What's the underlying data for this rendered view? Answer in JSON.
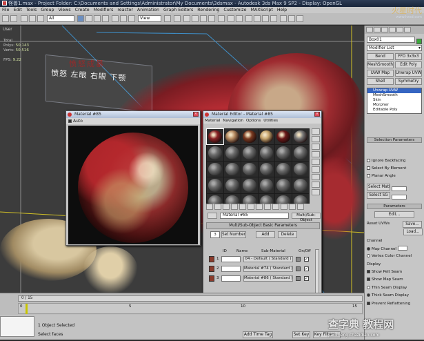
{
  "title": "怪兽1.max - Project Folder: C:\\Documents and Settings\\Administrator\\My Documents\\3dsmax - Autodesk 3ds Max 9 SP2 - Display: OpenGL",
  "menu": [
    "File",
    "Edit",
    "Tools",
    "Group",
    "Views",
    "Create",
    "Modifiers",
    "reactor",
    "Animation",
    "Graph Editors",
    "Rendering",
    "Customize",
    "MAXScript",
    "Help"
  ],
  "toolbar": {
    "selection_filter": "All",
    "ref_coord": "View"
  },
  "viewport": {
    "label": "User",
    "stats_total": "Total",
    "polys_label": "Polys:",
    "polys": "50,143",
    "verts_label": "Verts:",
    "verts": "50,516",
    "fps_label": "FPS:",
    "fps": "9.22",
    "banner_top": "愤怒成暴",
    "banner": "愤怒  左眼  右眼   下颚"
  },
  "logo": {
    "main": "火星时代",
    "sub": "www.hxsd.com"
  },
  "panel": {
    "object_name": "Box01",
    "modifier_list": "Modifier List",
    "buttons": [
      "Bend",
      "FFD 3x3x3",
      "MeshSmooth",
      "Edit Poly",
      "UVW Map",
      "Unwrap UVW",
      "Shell",
      "Symmetry"
    ],
    "stack": [
      "Unwrap UVW",
      "MeshSmooth",
      "Skin",
      "Morpher",
      "Editable Poly"
    ],
    "selection_params": "Selection Parameters",
    "ignore_backfacing": "Ignore Backfacing",
    "select_by_element": "Select By Element",
    "planar_angle": "Planar Angle",
    "select_matid": "Select MatID",
    "select_sg": "Select SG",
    "parameters": "Parameters",
    "edit_btn": "Edit...",
    "reset_uvws": "Reset UVWs",
    "save_btn": "Save...",
    "load_btn": "Load...",
    "channel": "Channel",
    "map_channel": "Map Channel",
    "vertex_color_channel": "Vertex Color Channel",
    "display": "Display",
    "show_pelt_seam": "Show Pelt Seam",
    "show_map_seam": "Show Map Seam",
    "thin_seam": "Thin Seam Display",
    "thick_seam": "Thick Seam Display",
    "prevent_reflattening": "Prevent Reflattening"
  },
  "mat_small": {
    "title": "Material #85",
    "auto": "Auto"
  },
  "medit": {
    "title": "Material Editor - Material #85",
    "menu": [
      "Material",
      "Navigation",
      "Options",
      "Utilities"
    ],
    "mat_name": "Material #85",
    "mat_type": "Multi/Sub-Object",
    "rollout": "Multi/Sub-Object Basic Parameters",
    "num_label": "3",
    "set_number": "Set Number",
    "add": "Add",
    "delete": "Delete",
    "col_id": "ID",
    "col_name": "Name",
    "col_sub": "Sub-Material",
    "col_onoff": "On/Off",
    "rows": [
      {
        "id": "1",
        "sub": "04 - Default  ( Standard )"
      },
      {
        "id": "2",
        "sub": "Material #74  ( Standard )"
      },
      {
        "id": "3",
        "sub": "Material #86  ( Standard )"
      }
    ]
  },
  "timeline": {
    "slider": "0 / 15",
    "ticks": [
      "0",
      "5",
      "10",
      "15"
    ]
  },
  "status": {
    "selected": "1 Object Selected",
    "prompt": "Select faces",
    "add_time_tag": "Add Time Tag",
    "set_key": "Set Key",
    "key_filters": "Key Filters..."
  },
  "watermark": {
    "main": "查字典 教程网",
    "sub": "jiaocheng.chazidian.com"
  },
  "colors": {
    "title_bar": "#24324a",
    "panel_bg": "#c6c6c6",
    "stack_selected": "#3565c2",
    "viewport": "#3c3c3c"
  }
}
